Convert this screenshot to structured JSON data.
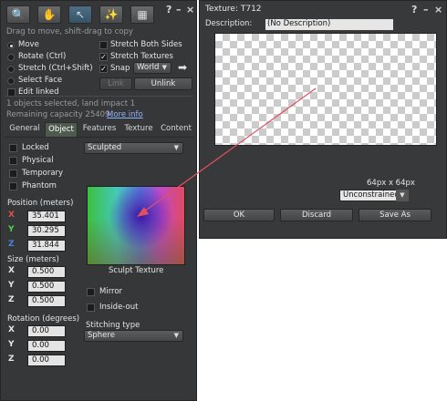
{
  "build": {
    "hint": "Drag to move, shift-drag to copy",
    "tools": [
      {
        "name": "focus-icon",
        "glyph": "🔍"
      },
      {
        "name": "move-hand-icon",
        "glyph": "✋"
      },
      {
        "name": "edit-cursor-icon",
        "glyph": "↖"
      },
      {
        "name": "create-wand-icon",
        "glyph": "✨"
      },
      {
        "name": "land-icon",
        "glyph": "▦"
      }
    ],
    "radios": [
      "Move",
      "Rotate (Ctrl)",
      "Stretch (Ctrl+Shift)",
      "Select Face"
    ],
    "edit_linked": "Edit linked",
    "stretch_both": "Stretch Both Sides",
    "stretch_textures": "Stretch Textures",
    "snap": "Snap",
    "snap_mode": "World",
    "link": "Link",
    "unlink": "Unlink",
    "selected_text": "1 objects selected, land impact 1",
    "remaining_text": "Remaining capacity 25409.",
    "more_info": "More info",
    "tabs": [
      "General",
      "Object",
      "Features",
      "Texture",
      "Content"
    ],
    "locked": "Locked",
    "physical": "Physical",
    "temporary": "Temporary",
    "phantom": "Phantom",
    "sculpt_type": "Sculpted",
    "position_label": "Position (meters)",
    "position": {
      "x": "35.401",
      "y": "30.295",
      "z": "31.844"
    },
    "size_label": "Size (meters)",
    "size": {
      "x": "0.500",
      "y": "0.500",
      "z": "0.500"
    },
    "rotation_label": "Rotation (degrees)",
    "rotation": {
      "x": "0.00",
      "y": "0.00",
      "z": "0.00"
    },
    "sculpt_texture_label": "Sculpt Texture",
    "mirror": "Mirror",
    "inside_out": "Inside-out",
    "stitching_label": "Stitching type",
    "stitching_value": "Sphere",
    "axes": {
      "x": "X",
      "y": "Y",
      "z": "Z"
    }
  },
  "texture": {
    "title": "Texture: T712",
    "description_label": "Description:",
    "description_value": "(No Description)",
    "dimensions": "64px x 64px",
    "aspect": "Unconstrained",
    "ok": "OK",
    "discard": "Discard",
    "save_as": "Save As"
  },
  "colors": {
    "axis_x": "#e05050",
    "axis_y": "#50d050",
    "axis_z": "#5080e0",
    "link_blue": "#8fb4ff",
    "arrow": "#e05060"
  }
}
